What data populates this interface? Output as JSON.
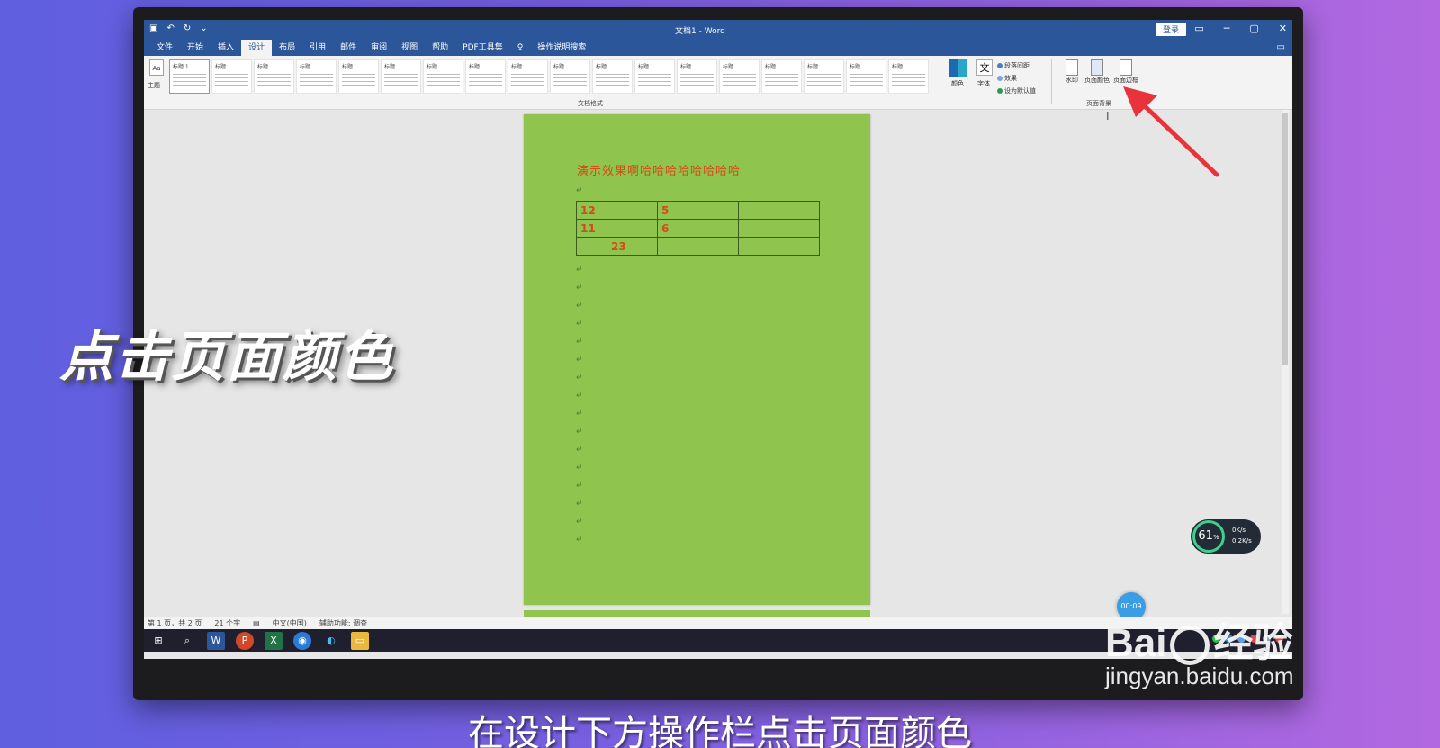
{
  "window": {
    "title": "文档1 - Word",
    "login": "登录"
  },
  "menu": [
    "文件",
    "开始",
    "插入",
    "设计",
    "布局",
    "引用",
    "邮件",
    "审阅",
    "视图",
    "帮助",
    "PDF工具集",
    "操作说明搜索"
  ],
  "ribbon": {
    "theme_label": "主题",
    "styles_label": "文档格式",
    "style_items": [
      "标题 1",
      "标题",
      "标题",
      "标题",
      "标题",
      "标题",
      "标题",
      "标题",
      "标题",
      "标题",
      "标题",
      "标题",
      "标题",
      "标题",
      "标题",
      "标题",
      "标题",
      "标题"
    ],
    "colors_label": "颜色",
    "font_label": "字体",
    "font_glyph": "文",
    "paragraph_spacing": "段落间距",
    "effects": "效果",
    "set_default": "设为默认值",
    "watermark": "水印",
    "page_color": "页面颜色",
    "page_borders": "页面边框",
    "page_background_label": "页面背景"
  },
  "document": {
    "title_plain": "演示效果啊",
    "title_underlined": "哈哈哈哈哈哈哈哈",
    "table": [
      [
        "12",
        "5",
        ""
      ],
      [
        "11",
        "6",
        ""
      ],
      [
        "23",
        "",
        ""
      ]
    ],
    "page_color": "#8fc44e"
  },
  "statusbar": {
    "pages": "第 1 页，共 2 页",
    "words": "21 个字",
    "language": "中文(中国)",
    "accessibility": "辅助功能: 调查"
  },
  "timer": "00:09",
  "speed": {
    "percent": "61",
    "unit": "%",
    "up": "0K/s",
    "down": "0.2K/s"
  },
  "overlay": {
    "title": "点击页面颜色",
    "subtitle": "在设计下方操作栏点击页面颜色"
  },
  "watermark": {
    "brand_left": "Bai",
    "brand_right": "经验",
    "url": "jingyan.baidu.com"
  }
}
